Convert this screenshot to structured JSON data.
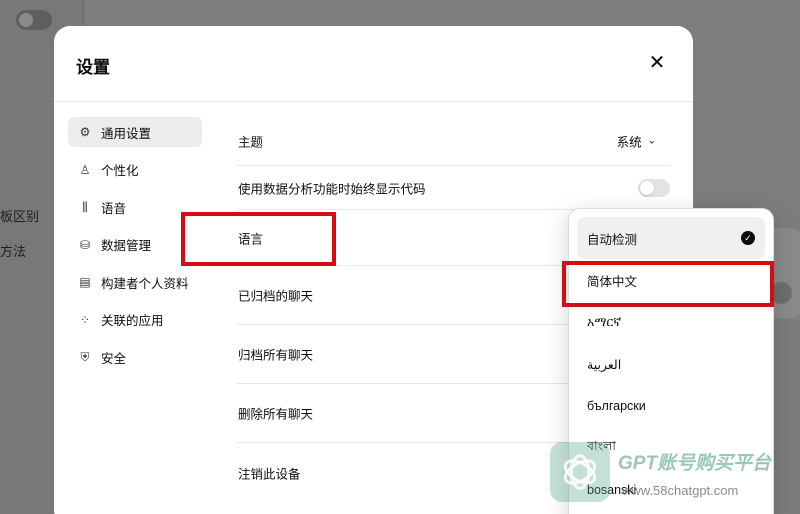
{
  "background": {
    "text_1": "板区别",
    "text_2": "方法"
  },
  "modal": {
    "title": "设置",
    "close_label": "✕"
  },
  "nav": {
    "items": [
      {
        "label": "通用设置",
        "icon": "gear-icon",
        "glyph": "⚙"
      },
      {
        "label": "个性化",
        "icon": "user-icon",
        "glyph": "♙"
      },
      {
        "label": "语音",
        "icon": "waveform-icon",
        "glyph": "⫼"
      },
      {
        "label": "数据管理",
        "icon": "database-icon",
        "glyph": "⛁"
      },
      {
        "label": "构建者个人资料",
        "icon": "id-card-icon",
        "glyph": "▤"
      },
      {
        "label": "关联的应用",
        "icon": "apps-grid-icon",
        "glyph": "⁘"
      },
      {
        "label": "安全",
        "icon": "shield-icon",
        "glyph": "⛨"
      }
    ]
  },
  "settings": {
    "theme_label": "主题",
    "theme_value": "系统",
    "analysis_label": "使用数据分析功能时始终显示代码",
    "language_label": "语言",
    "archived_label": "已归档的聊天",
    "archive_all_label": "归档所有聊天",
    "delete_all_label": "删除所有聊天",
    "logout_label": "注销此设备"
  },
  "language_dropdown": {
    "options": [
      "自动检测",
      "简体中文",
      "አማርኛ",
      "العربية",
      "български",
      "বাংলা",
      "bosanski"
    ],
    "selected": "自动检测"
  },
  "watermark": {
    "title": "GPT账号购买平台",
    "url": "www.58chatgpt.com"
  },
  "colors": {
    "highlight": "#d40d12",
    "active_nav_bg": "#ececec"
  }
}
